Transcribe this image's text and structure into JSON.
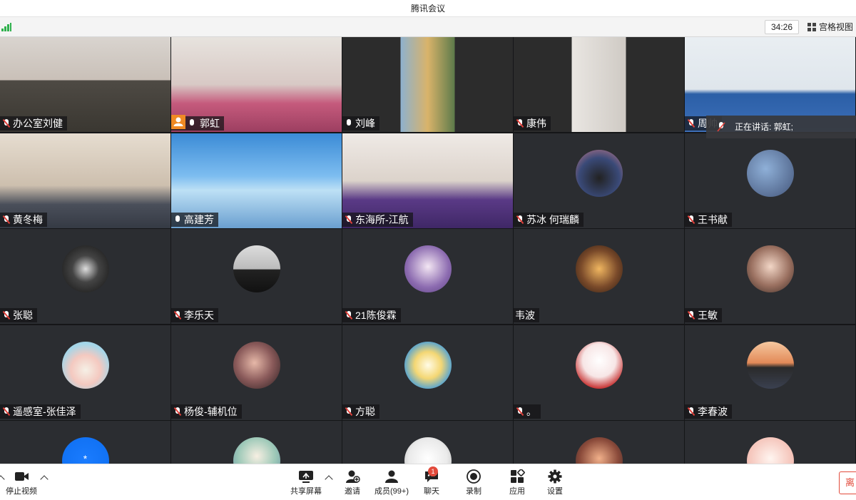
{
  "window": {
    "title": "腾讯会议"
  },
  "topbar": {
    "duration": "34:26",
    "view_mode": "宫格视图"
  },
  "speaking": {
    "label": "正在讲话: 郭虹;"
  },
  "participants": [
    {
      "name": "办公室刘健",
      "mic": "muted",
      "media": "video"
    },
    {
      "name": "郭虹",
      "mic": "on",
      "media": "video",
      "host": true
    },
    {
      "name": "刘峰",
      "mic": "on",
      "media": "video"
    },
    {
      "name": "康伟",
      "mic": "muted",
      "media": "video"
    },
    {
      "name": "周帅",
      "mic": "muted",
      "media": "video"
    },
    {
      "name": "黄冬梅",
      "mic": "muted",
      "media": "video"
    },
    {
      "name": "高建芳",
      "mic": "on",
      "media": "video"
    },
    {
      "name": "东海所-江航",
      "mic": "muted",
      "media": "video"
    },
    {
      "name": "苏冰 何瑞麟",
      "mic": "muted",
      "media": "avatar"
    },
    {
      "name": "王书献",
      "mic": "muted",
      "media": "avatar"
    },
    {
      "name": "张聪",
      "mic": "muted",
      "media": "avatar"
    },
    {
      "name": "李乐天",
      "mic": "muted",
      "media": "avatar"
    },
    {
      "name": "21陈俊霖",
      "mic": "muted",
      "media": "avatar"
    },
    {
      "name": "韦波",
      "mic": "none",
      "media": "avatar"
    },
    {
      "name": "王敏",
      "mic": "muted",
      "media": "avatar"
    },
    {
      "name": "遥感室-张佳泽",
      "mic": "muted",
      "media": "avatar"
    },
    {
      "name": "杨俊-辅机位",
      "mic": "muted",
      "media": "avatar"
    },
    {
      "name": "方聪",
      "mic": "muted",
      "media": "avatar"
    },
    {
      "name": "。",
      "mic": "muted",
      "media": "avatar"
    },
    {
      "name": "李春波",
      "mic": "muted",
      "media": "avatar"
    },
    {
      "name": "",
      "mic": "none",
      "media": "avatar",
      "avatar_text": "*"
    },
    {
      "name": "",
      "mic": "none",
      "media": "avatar"
    },
    {
      "name": "",
      "mic": "none",
      "media": "avatar"
    },
    {
      "name": "",
      "mic": "none",
      "media": "avatar"
    },
    {
      "name": "",
      "mic": "none",
      "media": "avatar"
    }
  ],
  "toolbar": {
    "stop_video": "停止视频",
    "share_screen": "共享屏幕",
    "invite": "邀请",
    "members": "成员(99+)",
    "chat": "聊天",
    "chat_unread": "1",
    "record": "录制",
    "apps": "应用",
    "settings": "设置",
    "leave": "离"
  },
  "colors": {
    "muted_slash": "#e2403a",
    "host_badge": "#f08a24",
    "signal": "#2fb14d",
    "tile_bg": "#2b2d31"
  }
}
